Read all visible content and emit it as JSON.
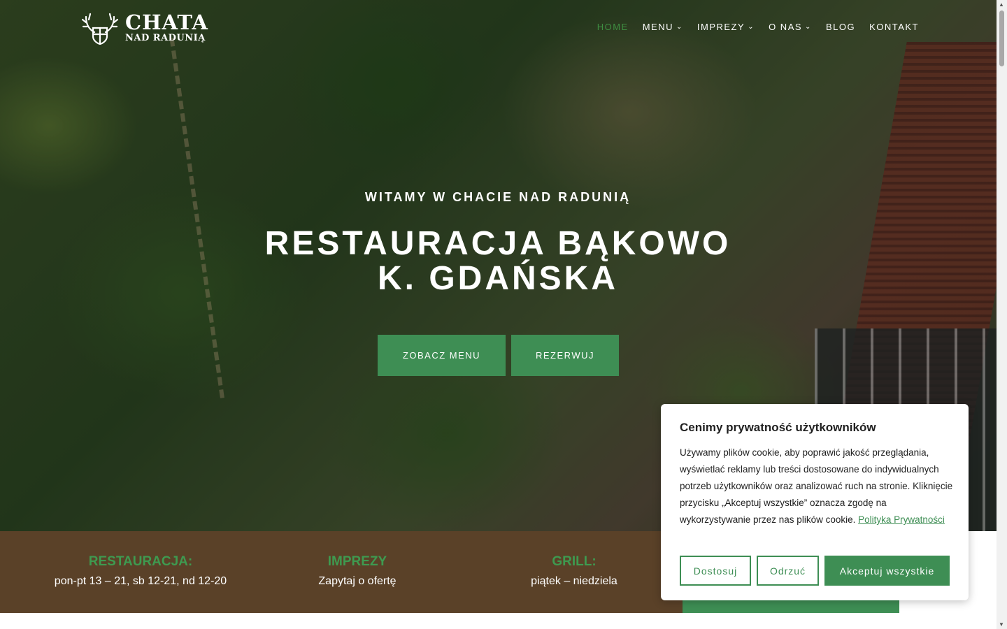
{
  "logo": {
    "line1": "CHATA",
    "line2": "NAD RADUNIĄ",
    "icon": "deer-antlers-shield-icon"
  },
  "nav": {
    "items": [
      {
        "label": "HOME",
        "active": true,
        "dropdown": false
      },
      {
        "label": "MENU",
        "active": false,
        "dropdown": true
      },
      {
        "label": "IMPREZY",
        "active": false,
        "dropdown": true
      },
      {
        "label": "O NAS",
        "active": false,
        "dropdown": true
      },
      {
        "label": "BLOG",
        "active": false,
        "dropdown": false
      },
      {
        "label": "KONTAKT",
        "active": false,
        "dropdown": false
      }
    ],
    "active_color": "#3e8e41"
  },
  "hero": {
    "eyebrow": "WITAMY W CHACIE NAD RADUNIĄ",
    "headline_line1": "RESTAURACJA BĄKOWO",
    "headline_line2": "K. GDAŃSKA",
    "cta_menu": "ZOBACZ MENU",
    "cta_book": "REZERWUJ"
  },
  "info": [
    {
      "title": "RESTAURACJA:",
      "value": "pon-pt 13 – 21, sb 12-21, nd 12-20"
    },
    {
      "title": "IMPREZY",
      "value": "Zapytaj o ofertę"
    },
    {
      "title": "GRILL:",
      "value": "piątek – niedziela"
    }
  ],
  "cookie": {
    "title": "Cenimy prywatność użytkowników",
    "body": "Używamy plików cookie, aby poprawić jakość przeglądania, wyświetlać reklamy lub treści dostosowane do indywidualnych potrzeb użytkowników oraz analizować ruch na stronie. Kliknięcie przycisku „Akceptuj wszystkie” oznacza zgodę na wykorzystywanie przez nas plików cookie.",
    "link": "Polityka Prywatności",
    "customize": "Dostosuj",
    "reject": "Odrzuć",
    "accept": "Akceptuj wszystkie"
  },
  "colors": {
    "brand_green": "#3e8e54",
    "info_bar_brown": "#5a4128"
  }
}
